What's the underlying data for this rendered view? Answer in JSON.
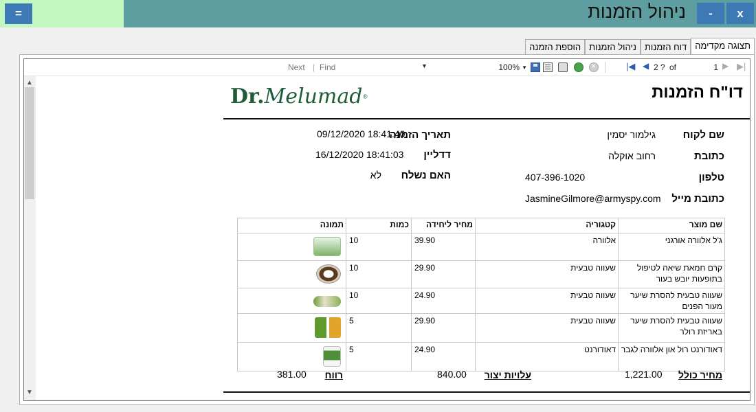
{
  "window": {
    "title": "ניהול הזמנות",
    "menu_label": "=",
    "minimize_label": "-",
    "close_label": "x",
    "colors": {
      "titlebar": "#5f9ea0",
      "menu_area": "#c2f7c2",
      "buttons": "#3d79b5"
    }
  },
  "tabs": [
    {
      "label": "הוספת הזמנה",
      "active": false
    },
    {
      "label": "ניהול הזמנות",
      "active": false
    },
    {
      "label": "דוח הזמנות",
      "active": false
    },
    {
      "label": "תצוגה מקדימה",
      "active": true
    }
  ],
  "toolbar": {
    "next_label": "Next",
    "separator": "|",
    "find_label": "Find",
    "zoom": "100%",
    "page_current": "1",
    "of_label": "of",
    "page_total": "2 ?"
  },
  "report": {
    "title": "דו\"ח הזמנות",
    "logo_dr": "Dr.",
    "logo_name": "Melumad",
    "logo_mark": "®",
    "customer": {
      "name_label": "שם לקוח",
      "name_value": "גילמור יסמין",
      "address_label": "כתובת",
      "address_value": "רחוב אוקלה",
      "phone_label": "טלפון",
      "phone_value": "407-396-1020",
      "email_label": "כתובת מייל",
      "email_value": "JasmineGilmore@armyspy.com"
    },
    "order": {
      "date_label": "תאריך הזמנה",
      "date_value": "09/12/2020 18:41:40",
      "deadline_label": "דדליין",
      "deadline_value": "16/12/2020 18:41:03",
      "shipped_label": "האם נשלח",
      "shipped_value": "לא"
    },
    "table": {
      "headers": {
        "product": "שם מוצר",
        "category": "קטגוריה",
        "unit_price": "מחיר ליחידה",
        "quantity": "כמות",
        "image": "תמונה"
      },
      "rows": [
        {
          "product": "ג'ל אלוורה אורגני",
          "category": "אלוורה",
          "unit_price": "39.90",
          "quantity": "10",
          "image": "aloe-gel-box"
        },
        {
          "product": "קרם חמאת שיאה לטיפול בתופעות יובש בעור",
          "category": "שעווה טבעית",
          "unit_price": "29.90",
          "quantity": "10",
          "image": "shea-cream-jar"
        },
        {
          "product": "שעווה טבעית להסרת שיער מעור הפנים",
          "category": "שעווה טבעית",
          "unit_price": "24.90",
          "quantity": "10",
          "image": "face-wax-strip"
        },
        {
          "product": "שעווה טבעית להסרת שיער באריזת רולר",
          "category": "שעווה טבעית",
          "unit_price": "29.90",
          "quantity": "5",
          "image": "roller-wax-pack"
        },
        {
          "product": "דאודורנט רול און אלוורה לגבר",
          "category": "דאודורנט",
          "unit_price": "24.90",
          "quantity": "5",
          "image": "rollon-deodorant"
        }
      ]
    },
    "summary": {
      "total_label": "מחיר כולל",
      "total_value": "1,221.00",
      "cost_label": "עלויות יצור",
      "cost_value": "840.00",
      "profit_label": "רווח",
      "profit_value": "381.00"
    }
  }
}
